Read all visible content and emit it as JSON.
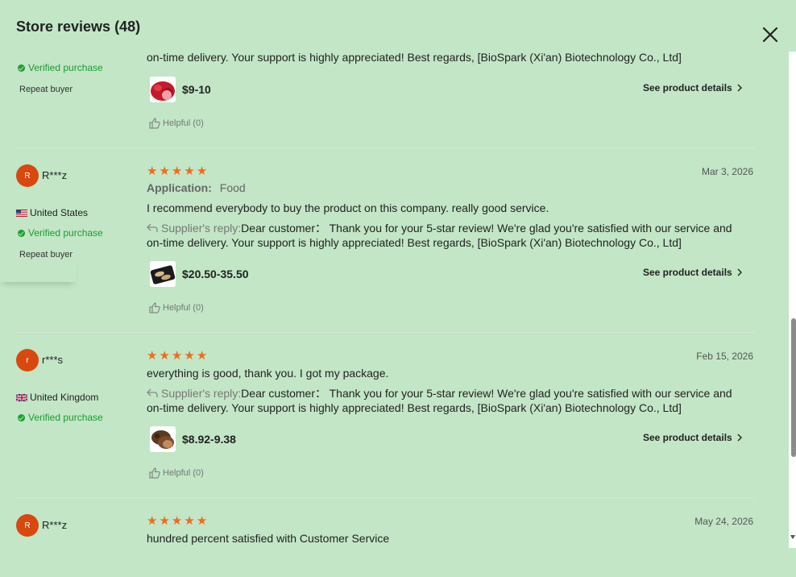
{
  "header": {
    "title": "Store reviews (48)"
  },
  "review0": {
    "verified": "Verified purchase",
    "repeat": "Repeat buyer",
    "reply_tail": "on-time delivery. Your support is highly appreciated! Best regards, [BioSpark (Xi'an) Biotechnology Co., Ltd]",
    "price": "$9-10",
    "details": "See product details",
    "helpful": "Helpful (0)"
  },
  "review1": {
    "initial": "R",
    "name": "R***z",
    "country": "United States",
    "verified": "Verified purchase",
    "repeat": "Repeat buyer",
    "date": "Mar 3, 2026",
    "app_label": "Application:",
    "app_value": "Food",
    "text": "I recommend everybody to buy the product on this company. really good service.",
    "reply_label": "Supplier's reply:",
    "reply_text": "Dear customer：  Thank you for your 5-star review! We're glad you're satisfied with our service and on-time delivery. Your support is highly appreciated! Best regards, [BioSpark (Xi'an) Biotechnology Co., Ltd]",
    "price": "$20.50-35.50",
    "details": "See product details",
    "helpful": "Helpful (0)"
  },
  "review2": {
    "initial": "r",
    "name": "r***s",
    "country": "United Kingdom",
    "verified": "Verified purchase",
    "date": "Feb 15, 2026",
    "text": "everything is good, thank you. I got my package.",
    "reply_label": "Supplier's reply:",
    "reply_text": "Dear customer：  Thank you for your 5-star review! We're glad you're satisfied with our service and on-time delivery. Your support is highly appreciated! Best regards, [BioSpark (Xi'an) Biotechnology Co., Ltd]",
    "price": "$8.92-9.38",
    "details": "See product details",
    "helpful": "Helpful (0)"
  },
  "review3": {
    "initial": "R",
    "name": "R***z",
    "date": "May 24, 2026",
    "text": "hundred percent satisfied with Customer Service"
  },
  "rating": {
    "stars": 5,
    "star_color": "#f06a1e"
  },
  "colors": {
    "verified": "#1e9b32",
    "avatar": "#d9480f",
    "background": "#c2e6c6"
  }
}
